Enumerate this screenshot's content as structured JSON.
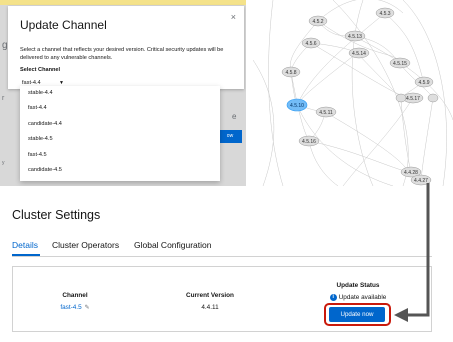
{
  "modal": {
    "title": "Update Channel",
    "description": "Select a channel that reflects your desired version. Critical security updates will be delivered to any vulnerable channels.",
    "select_label": "Select Channel",
    "selected_value": "fast-4.4",
    "close_icon": "×",
    "options": [
      "stable-4.4",
      "fast-4.4",
      "candidate-4.4",
      "stable-4.5",
      "fast-4.5",
      "candidate-4.5"
    ]
  },
  "graph_nodes": {
    "n1": "4.5.2",
    "n2": "4.5.3",
    "n3": "4.5.6",
    "n4": "4.5.13",
    "n5": "4.5.14",
    "n6": "4.5.8",
    "n7": "4.5.15",
    "n8": "4.5.9",
    "n9": "4.5.10",
    "n10": "4.5.11",
    "n11": "4.5.17",
    "n12": "4.5.16",
    "n13": "4.4.28",
    "n14": "4.4.27"
  },
  "page": {
    "title": "Cluster Settings",
    "tabs": [
      "Details",
      "Cluster Operators",
      "Global Configuration"
    ]
  },
  "details": {
    "channel_header": "Channel",
    "channel_value": "fast-4.5",
    "version_header": "Current Version",
    "version_value": "4.4.11",
    "status_header": "Update Status",
    "status_value": "Update available",
    "update_button": "Update now"
  },
  "colors": {
    "accent": "#0066cc",
    "highlight": "#c9190b",
    "annotation_arrow": "#555555"
  }
}
